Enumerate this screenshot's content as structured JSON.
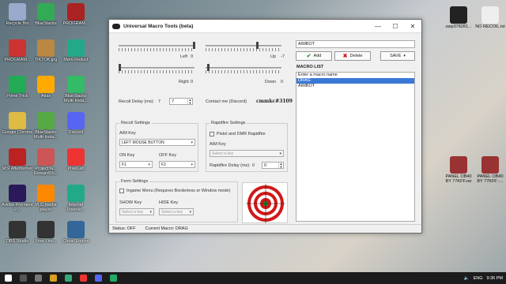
{
  "desktop": {
    "left_icons": [
      {
        "label": "Recycle Bin",
        "color": "#9ac"
      },
      {
        "label": "PROGRAM...",
        "color": "#c33"
      },
      {
        "label": "Prime Trick",
        "color": "#2a5"
      },
      {
        "label": "Google Chrome",
        "color": "#db4"
      },
      {
        "label": "MSI Afterburner",
        "color": "#b22"
      },
      {
        "label": "Adobe Premiere P...",
        "color": "#2a1a5a"
      },
      {
        "label": "OBS Studio",
        "color": "#333"
      },
      {
        "label": "BlueStacks",
        "color": "#3a5"
      },
      {
        "label": "TIKTOK.jpg",
        "color": "#b84"
      },
      {
        "label": "Atlas",
        "color": "#fa0"
      },
      {
        "label": "BlueStacks Multi-Insta...",
        "color": "#5a4"
      },
      {
        "label": "ProjectTa... RewardSh...",
        "color": "#c55"
      },
      {
        "label": "VLC media player",
        "color": "#f80"
      },
      {
        "label": "Free Fire...",
        "color": "#333"
      },
      {
        "label": "PROGRAM...",
        "color": "#a22"
      },
      {
        "label": "Mem Reduct",
        "color": "#2a8"
      },
      {
        "label": "BlueStacks Multi-Insta...",
        "color": "#3b6"
      },
      {
        "label": "Discord",
        "color": "#5865f2"
      },
      {
        "label": "PixelLab",
        "color": "#e33"
      },
      {
        "label": "Internet Downlo...",
        "color": "#2a8"
      },
      {
        "label": "Cheat Engine",
        "color": "#369"
      }
    ],
    "right_icons": [
      {
        "label": "uwp378281...",
        "color": "#222"
      },
      {
        "label": "NO RECOIL.txt",
        "color": "#eee"
      },
      {
        "label": "PANEL OB40 BY 77KFF.rar",
        "color": "#933"
      },
      {
        "label": "PANEL OB40 BY 77KFF -...",
        "color": "#933"
      }
    ]
  },
  "window": {
    "title": "Universal Macro Tools (beta)",
    "minimize": "—",
    "maximize": "☐",
    "close": "✕",
    "sliders": {
      "left_label": "Left",
      "left_value": "0",
      "up_label": "Up",
      "up_value": "-7",
      "right_label": "Right",
      "right_value": "0",
      "down_label": "Down",
      "down_value": "0"
    },
    "recoil_delay_label": "Recoil Delay (ms):",
    "recoil_delay_value": "7",
    "recoil_delay_spin": "7",
    "contact_label": "Contact me (Discord)",
    "contact_value": "cmmkc#3109",
    "recoil_settings": {
      "title": "Recoil Settings",
      "aim_key_label": "AIM Key",
      "aim_key_value": "LEFT MOUSE BUTTON",
      "on_key_label": "ON Key",
      "on_key_value": "F1",
      "off_key_label": "OFF Key",
      "off_key_value": "F2"
    },
    "rapidfire_settings": {
      "title": "Rapidfire Settings",
      "pistol_label": "Pistol and DMR Rapidfire",
      "aim_key_label": "AIM Key",
      "aim_key_placeholder": "Select a key",
      "delay_label": "Rapidfire Delay (ms):",
      "delay_value": "0",
      "delay_spin": "0"
    },
    "form_settings": {
      "title": "Form Settings",
      "ingame_label": "Ingame Menu (Requires Borderless or Window mode)",
      "show_key_label": "SHOW Key",
      "show_key_placeholder": "Select a key",
      "hide_key_label": "HIDE Key",
      "hide_key_placeholder": "Select a key"
    },
    "macro": {
      "name_value": "AIMBOT",
      "add_label": "Add",
      "delete_label": "Delete",
      "save_label": "SAVE",
      "list_title": "MACRO LIST",
      "list_items": [
        "Enter a macro name",
        "DRAG",
        "AIMBOT"
      ],
      "selected_index": 1
    },
    "status": {
      "status_text": "Status: OFF",
      "current_macro_text": "Current Macro: DRAG"
    }
  },
  "taskbar": {
    "time": "9:36 PM",
    "lang": "ENG"
  },
  "colors": {
    "selection": "#3a78d6",
    "add_check": "#2a9a2a",
    "delete_x": "#cc2222",
    "target_red": "#d01818"
  }
}
